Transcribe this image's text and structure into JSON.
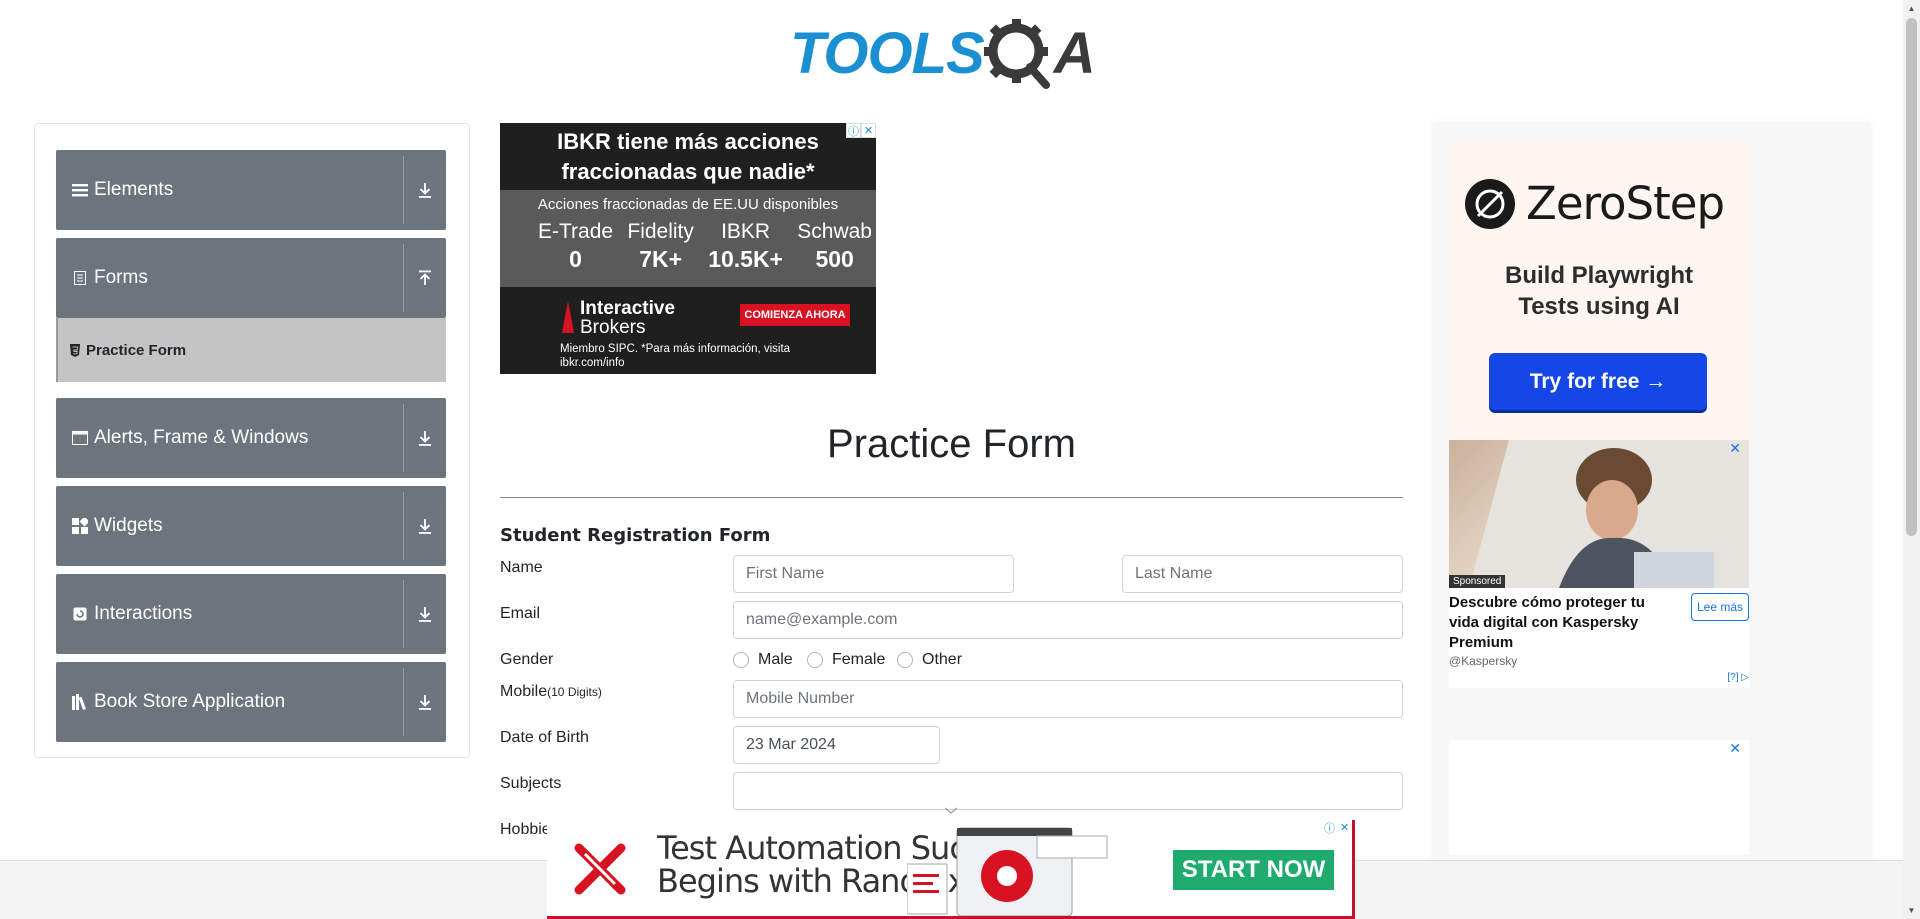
{
  "header": {
    "logo_text_tools": "TOOLS",
    "logo_text_qa": "A"
  },
  "sidebar": {
    "groups": [
      {
        "label": "Elements",
        "icon": "hamburger-icon",
        "expanded": false
      },
      {
        "label": "Forms",
        "icon": "document-icon",
        "expanded": true
      },
      {
        "label": "Alerts, Frame & Windows",
        "icon": "window-icon",
        "expanded": false
      },
      {
        "label": "Widgets",
        "icon": "widgets-icon",
        "expanded": false
      },
      {
        "label": "Interactions",
        "icon": "interactions-icon",
        "expanded": false
      },
      {
        "label": "Book Store Application",
        "icon": "books-icon",
        "expanded": false
      }
    ],
    "active_item": "Practice Form"
  },
  "ad_top": {
    "title": "IBKR tiene más acciones fraccionadas que nadie*",
    "subtitle": "Acciones fraccionadas de EE.UU disponibles",
    "columns": [
      {
        "name": "E-Trade",
        "value": "0"
      },
      {
        "name": "Fidelity",
        "value": "7K+"
      },
      {
        "name": "IBKR",
        "value": "10.5K+"
      },
      {
        "name": "Schwab",
        "value": "500"
      }
    ],
    "brand_line1": "Interactive",
    "brand_line2": "Brokers",
    "cta": "COMIENZA AHORA",
    "fine_print_1": "Miembro SIPC. *Para más información, visita",
    "fine_print_2": "ibkr.com/info"
  },
  "form": {
    "page_title": "Practice Form",
    "heading": "Student Registration Form",
    "labels": {
      "name": "Name",
      "email": "Email",
      "gender": "Gender",
      "mobile": "Mobile",
      "mobile_hint": "(10 Digits)",
      "dob": "Date of Birth",
      "subjects": "Subjects",
      "hobbies": "Hobbie"
    },
    "placeholders": {
      "first_name": "First Name",
      "last_name": "Last Name",
      "email": "name@example.com",
      "mobile": "Mobile Number"
    },
    "gender_options": [
      "Male",
      "Female",
      "Other"
    ],
    "dob_value": "23 Mar 2024"
  },
  "ad_right": {
    "zerostep_name": "ZeroStep",
    "zerostep_tagline": "Build Playwright Tests using AI",
    "zerostep_cta": "Try for free →",
    "ksp_sponsored": "Sponsored",
    "ksp_headline": "Descubre cómo proteger tu vida digital con Kaspersky Premium",
    "ksp_more": "Lee más",
    "ksp_by": "@Kaspersky",
    "ksp_q": "[?]"
  },
  "ad_bottom": {
    "line1": "Test Automation Success",
    "line2": "Begins with Ranorex",
    "cta": "START NOW"
  }
}
